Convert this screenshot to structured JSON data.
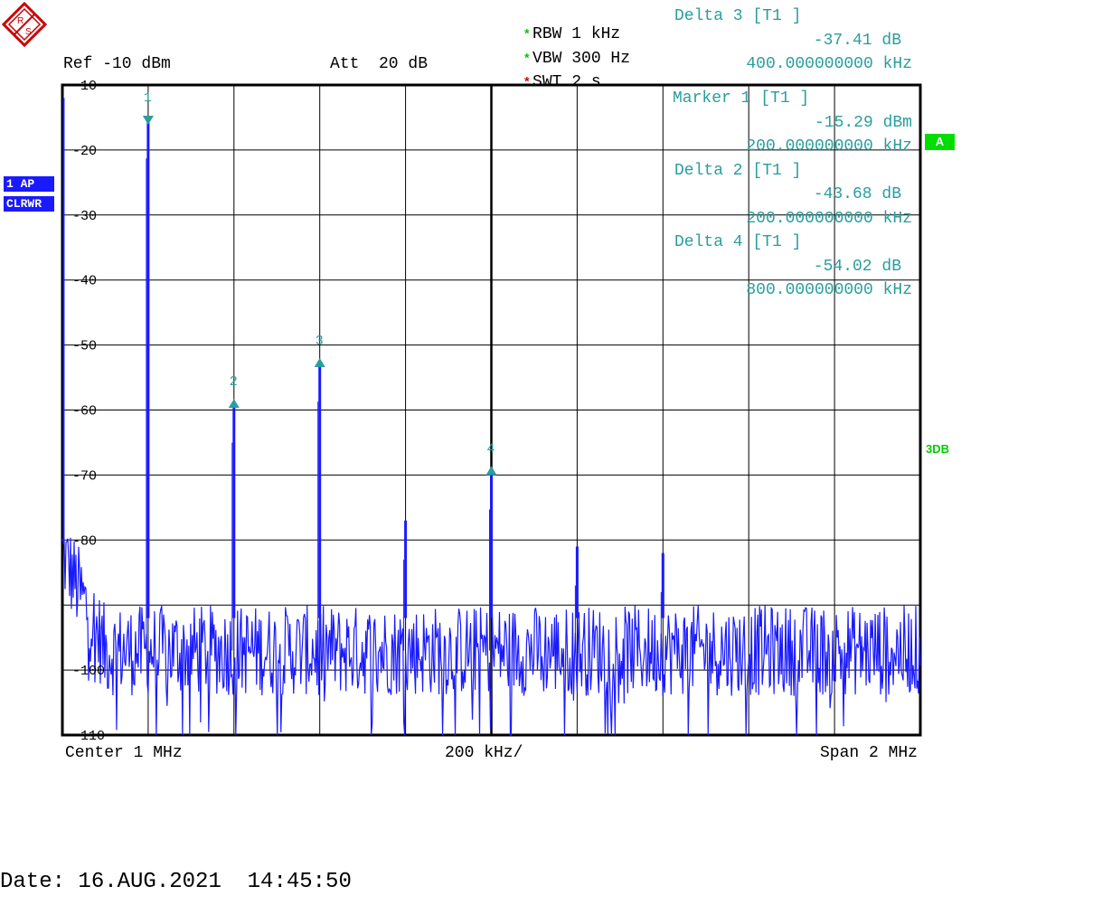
{
  "header": {
    "rbw": "RBW 1 kHz",
    "vbw": "VBW 300 Hz",
    "swt": "SWT 2 s",
    "ref": "Ref -10 dBm",
    "att": "Att  20 dB",
    "star": "*",
    "star_colors": {
      "rbw": "#00cc00",
      "vbw": "#00cc00",
      "swt": "#e00000"
    }
  },
  "marker_info": [
    {
      "title": "Delta 3 [T1 ]",
      "level": "-37.41 dB",
      "freq": "400.000000000 kHz"
    },
    {
      "title": "Marker 1 [T1 ]",
      "level": "-15.29 dBm",
      "freq": "200.000000000 kHz"
    },
    {
      "title": "Delta 2 [T1 ]",
      "level": "-43.68 dB",
      "freq": "200.000000000 kHz"
    },
    {
      "title": "Delta 4 [T1 ]",
      "level": "-54.02 dB",
      "freq": "800.000000000 kHz"
    }
  ],
  "side": {
    "trace_mode": "1 AP",
    "clear_write": "CLRWR",
    "channel": "A",
    "bw_flag": "3DB"
  },
  "footer": {
    "center": "Center 1 MHz",
    "div": "200 kHz/",
    "span": "Span 2 MHz",
    "date": "Date: 16.AUG.2021  14:45:50"
  },
  "colors": {
    "trace": "#1a1aff",
    "marker": "#2a9d9d",
    "grid": "#000000",
    "badge_green": "#00dd00"
  },
  "icons": {
    "logo": "rohde-schwarz-logo"
  },
  "chart_data": {
    "type": "line",
    "xlabel": "",
    "ylabel": "",
    "x_unit": "MHz",
    "xlim": [
      0,
      2
    ],
    "ylim": [
      -110,
      -10
    ],
    "y_unit": "dBm",
    "y_ticks": [
      -10,
      -20,
      -30,
      -40,
      -50,
      -60,
      -70,
      -80,
      -90,
      -100,
      -110
    ],
    "y_tick_labels": [
      "-10",
      "-20",
      "-30",
      "-40",
      "-50",
      "-60",
      "-70",
      "-80",
      "",
      "-100",
      "-110"
    ],
    "grid": true,
    "noise_floor_dbm": -97,
    "series": [
      {
        "peaks": [
          {
            "x": 0.2,
            "y": -15.3
          },
          {
            "x": 0.4,
            "y": -59
          },
          {
            "x": 0.6,
            "y": -52.7
          },
          {
            "x": 0.8,
            "y": -77
          },
          {
            "x": 1.0,
            "y": -69.3
          },
          {
            "x": 1.2,
            "y": -81
          },
          {
            "x": 1.4,
            "y": -82
          }
        ]
      }
    ],
    "markers": [
      {
        "label": "1",
        "x": 0.2,
        "y": -15.29,
        "shape": "down"
      },
      {
        "label": "2",
        "x": 0.4,
        "y": -58.97,
        "shape": "up"
      },
      {
        "label": "3",
        "x": 0.6,
        "y": -52.7,
        "shape": "up"
      },
      {
        "label": "4",
        "x": 1.0,
        "y": -69.31,
        "shape": "up"
      }
    ]
  }
}
